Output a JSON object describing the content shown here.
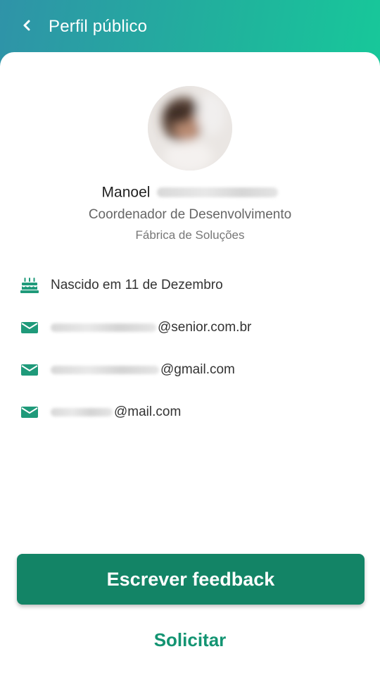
{
  "header": {
    "title": "Perfil público",
    "back_icon": "chevron-left-icon"
  },
  "profile": {
    "first_name": "Manoel",
    "role": "Coordenador de Desenvolvimento",
    "department": "Fábrica de Soluções"
  },
  "info": [
    {
      "icon": "birthday-cake-icon",
      "text": "Nascido em 11 de Dezembro"
    },
    {
      "icon": "mail-icon",
      "text": "@senior.com.br"
    },
    {
      "icon": "mail-icon",
      "text": "@gmail.com"
    },
    {
      "icon": "mail-icon",
      "text": "@mail.com"
    }
  ],
  "actions": {
    "primary_label": "Escrever feedback",
    "secondary_label": "Solicitar"
  },
  "colors": {
    "header_gradient_start": "#2f93a8",
    "header_gradient_end": "#17c89a",
    "primary": "#138466",
    "accent": "#139472",
    "icon": "#1f9a7a"
  }
}
